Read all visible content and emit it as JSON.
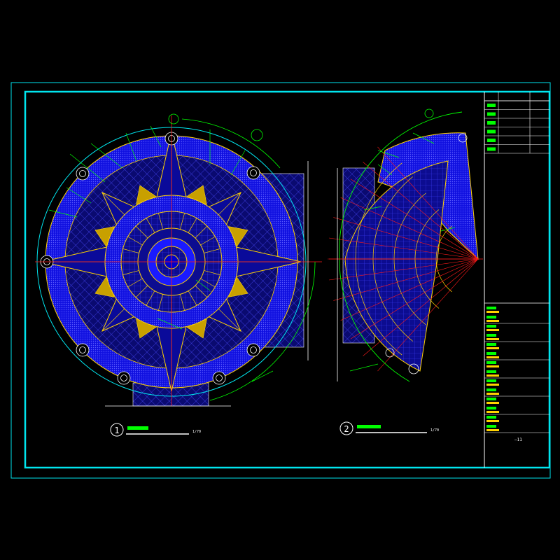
{
  "drawing": {
    "colors": {
      "background": "#000000",
      "frame": "#00e5ee",
      "paving": "#1a1aff",
      "grid": "#3b3bff",
      "outline": "#ffd200",
      "star": "#0a0a9a",
      "accent_red": "#ff1a1a",
      "leader_green": "#00ff00",
      "dim_white": "#ffffff"
    },
    "views": [
      {
        "number": "1",
        "scale": "1/70"
      },
      {
        "number": "2",
        "scale": "1/70"
      }
    ],
    "title_block": {
      "header": [
        "",
        "",
        ""
      ],
      "revision_rows": 6,
      "sheet_no": "—11"
    }
  }
}
